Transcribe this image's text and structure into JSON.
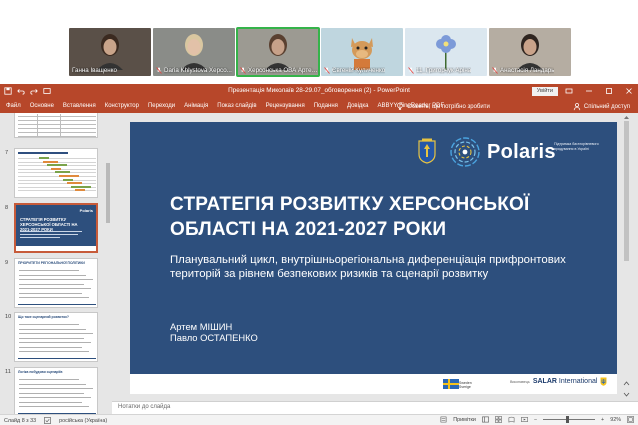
{
  "call": {
    "participants": [
      {
        "name": "Ганна Іващенко",
        "muted": false,
        "kind": "photo",
        "skin": "#c9a48a",
        "hair": "#3b2a20",
        "bg": "#5a5048"
      },
      {
        "name": "Daria Khlystova Херсо...",
        "muted": true,
        "kind": "photo",
        "skin": "#e2c1a8",
        "hair": "#d9c7a0",
        "bg": "#8a8c88"
      },
      {
        "name": "Херсонська ОВА Артем ...",
        "muted": true,
        "kind": "photo",
        "skin": "#c7a189",
        "hair": "#5a4030",
        "bg": "#9c9a92",
        "active": true
      },
      {
        "name": "Євгеній Куличенко",
        "muted": true,
        "kind": "cartoon",
        "skin": "#d49a5a",
        "hair": "#e7b980",
        "bg": "#bfd6df"
      },
      {
        "name": "11_Григорчук Аріна",
        "muted": true,
        "kind": "flower",
        "skin": "#7c9ad8",
        "hair": "#3e6a2f",
        "bg": "#dbe7ef"
      },
      {
        "name": "Анастасія Ландарь",
        "muted": true,
        "kind": "photo",
        "skin": "#caa38a",
        "hair": "#2f2520",
        "bg": "#b5ada2"
      }
    ]
  },
  "titlebar": {
    "title": "Презентація Миколаїв 28-29.07_обговорення (2) - PowerPoint",
    "signin": "Увійти"
  },
  "ribbon": {
    "tabs": [
      "Файл",
      "Основне",
      "Вставлення",
      "Конструктор",
      "Переходи",
      "Анімація",
      "Показ слайдів",
      "Рецензування",
      "Подання",
      "Довідка",
      "ABBYY FineReader PDF"
    ],
    "tell_me": "Скажіть, що потрібно зробити",
    "share": "Спільний доступ"
  },
  "thumbnails": [
    {
      "number": "",
      "kind": "table"
    },
    {
      "number": "7",
      "kind": "gantt"
    },
    {
      "number": "8",
      "kind": "title",
      "selected": true,
      "title": "СТРАТЕГІЯ РОЗВИТКУ ХЕРСОНСЬКОЇ ОБЛАСТІ НА 2021-2027 РОКИ"
    },
    {
      "number": "9",
      "kind": "text",
      "title": "ПРІОРИТЕТИ РЕГІОНАЛЬНОЇ ПОЛІТИКИ"
    },
    {
      "number": "10",
      "kind": "text",
      "title": "Що таке сценарний розвиток?"
    },
    {
      "number": "11",
      "kind": "text",
      "title": "Логіка побудови сценаріїв"
    }
  ],
  "slide": {
    "logo_name": "Polaris",
    "logo_sub": "Підтримка багаторівневого врядування в Україні",
    "title": "СТРАТЕГІЯ РОЗВИТКУ ХЕРСОНСЬКОЇ ОБЛАСТІ НА 2021-2027 РОКИ",
    "subtitle": "Планувальний цикл, внутрішньорегіональна диференціація прифронтових територій за рівнем безпекових ризиків та сценарії розвитку",
    "authors": [
      "Артем МІШИН",
      "Павло ОСТАПЕНКО"
    ],
    "footer": {
      "sweden_line1": "Sweden",
      "sweden_line2": "Sverige",
      "salar_small": "Виконавець",
      "salar_bold": "SALAR",
      "salar_light": " International"
    }
  },
  "notes": {
    "placeholder": "Нотатки до слайда"
  },
  "status": {
    "slide_info": "Слайд 8 з 33",
    "language": "російська (Україна)",
    "notes_label": "Примітки",
    "zoom": "92%",
    "zoom_fraction": 0.47
  },
  "colors": {
    "accent": "#b7472a",
    "slide_bg": "#2d4f7d",
    "active_speaker": "#35b34a"
  }
}
